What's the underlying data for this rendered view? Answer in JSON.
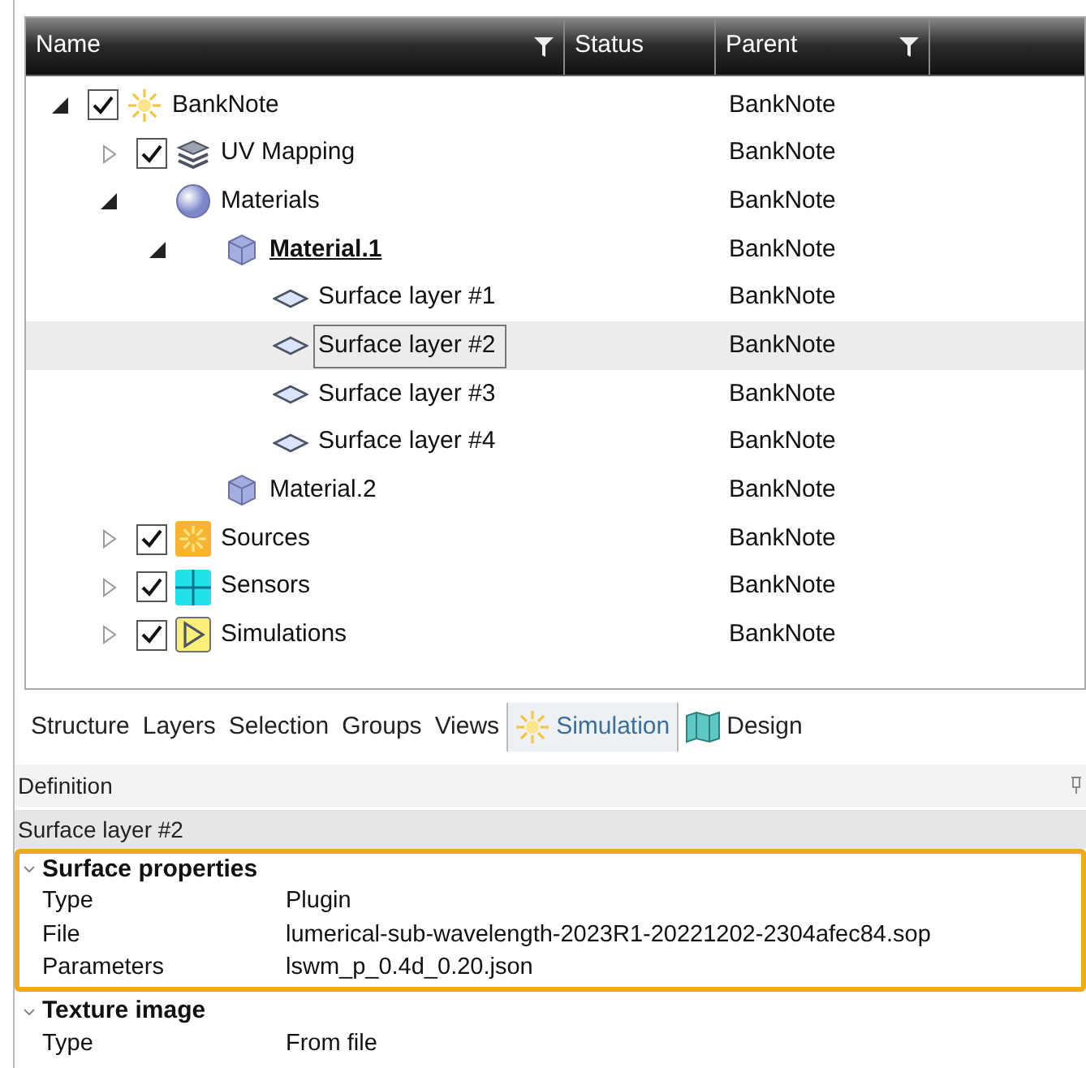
{
  "tree": {
    "columns": [
      {
        "label": "Name",
        "filter": true
      },
      {
        "label": "Status",
        "filter": false
      },
      {
        "label": "Parent",
        "filter": true
      }
    ],
    "nodes": [
      {
        "label": "BankNote",
        "kind": "scene",
        "expanded": true,
        "checked": true,
        "selected": false,
        "active": false,
        "parent": "BankNote",
        "children": [
          {
            "label": "UV Mapping",
            "kind": "layers",
            "expanded": false,
            "checked": true,
            "selected": false,
            "active": false,
            "parent": "BankNote"
          },
          {
            "label": "Materials",
            "kind": "sphere",
            "expanded": true,
            "selected": false,
            "active": false,
            "parent": "BankNote",
            "children": [
              {
                "label": "Material.1",
                "kind": "cube",
                "expanded": true,
                "selected": false,
                "active": true,
                "parent": "BankNote",
                "children": [
                  {
                    "label": "Surface layer #1",
                    "kind": "surface",
                    "selected": false,
                    "active": false,
                    "parent": "BankNote"
                  },
                  {
                    "label": "Surface layer #2",
                    "kind": "surface",
                    "selected": true,
                    "active": false,
                    "parent": "BankNote"
                  },
                  {
                    "label": "Surface layer #3",
                    "kind": "surface",
                    "selected": false,
                    "active": false,
                    "parent": "BankNote"
                  },
                  {
                    "label": "Surface layer #4",
                    "kind": "surface",
                    "selected": false,
                    "active": false,
                    "parent": "BankNote"
                  }
                ]
              },
              {
                "label": "Material.2",
                "kind": "cube",
                "selected": false,
                "active": false,
                "parent": "BankNote"
              }
            ]
          },
          {
            "label": "Sources",
            "kind": "source",
            "expanded": false,
            "checked": true,
            "selected": false,
            "active": false,
            "parent": "BankNote"
          },
          {
            "label": "Sensors",
            "kind": "sensor",
            "expanded": false,
            "checked": true,
            "selected": false,
            "active": false,
            "parent": "BankNote"
          },
          {
            "label": "Simulations",
            "kind": "simulation",
            "expanded": false,
            "checked": true,
            "selected": false,
            "active": false,
            "parent": "BankNote"
          }
        ]
      }
    ]
  },
  "tabs": [
    {
      "label": "Structure",
      "selected": false
    },
    {
      "label": "Layers",
      "selected": false
    },
    {
      "label": "Selection",
      "selected": false
    },
    {
      "label": "Groups",
      "selected": false
    },
    {
      "label": "Views",
      "selected": false
    },
    {
      "label": "Simulation",
      "selected": true,
      "kind": "sun"
    },
    {
      "label": "Design",
      "selected": false,
      "kind": "map"
    }
  ],
  "definition": {
    "title": "Definition",
    "object": "Surface layer #2",
    "groups": [
      {
        "title": "Surface properties",
        "highlighted": true,
        "rows": [
          {
            "name": "Type",
            "value": "Plugin"
          },
          {
            "name": "File",
            "value": "lumerical-sub-wavelength-2023R1-20221202-2304afec84.sop"
          },
          {
            "name": "Parameters",
            "value": "lswm_p_0.4d_0.20.json"
          }
        ]
      },
      {
        "title": "Texture image",
        "highlighted": false,
        "rows": [
          {
            "name": "Type",
            "value": "From file"
          }
        ]
      }
    ]
  }
}
